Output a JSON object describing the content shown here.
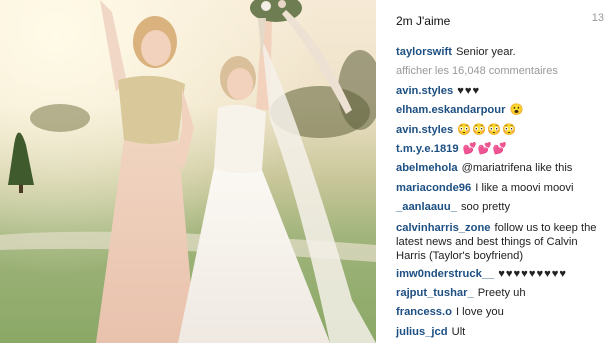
{
  "post": {
    "likes": "2m J'aime",
    "corner_number": "13",
    "caption": {
      "user": "taylorswift",
      "text": "Senior year."
    },
    "view_all": "afficher les 16,048 commentaires"
  },
  "comments": [
    {
      "user": "avin.styles",
      "text": "♥♥♥"
    },
    {
      "user": "elham.eskandarpour",
      "text": "😮"
    },
    {
      "user": "avin.styles",
      "text": "😳😳😳😳"
    },
    {
      "user": "t.m.y.e.1819",
      "text": "💕💕💕"
    },
    {
      "user": "abelmehola",
      "text": "@mariatrifena like this"
    },
    {
      "user": "mariaconde96",
      "text": "I like a moovi moovi"
    },
    {
      "user": "_aanlaauu_",
      "text": "soo pretty"
    },
    {
      "user": "calvinharris_zone",
      "text": "follow us to keep the latest news and best things of Calvin Harris (Taylor's boyfriend)"
    },
    {
      "user": "imw0nderstruck__",
      "text": "♥♥♥♥♥♥♥♥♥"
    },
    {
      "user": "rajput_tushar_",
      "text": "Preety uh"
    },
    {
      "user": "francess.o",
      "text": "I love you"
    },
    {
      "user": "julius_jcd",
      "text": "Ult"
    }
  ]
}
